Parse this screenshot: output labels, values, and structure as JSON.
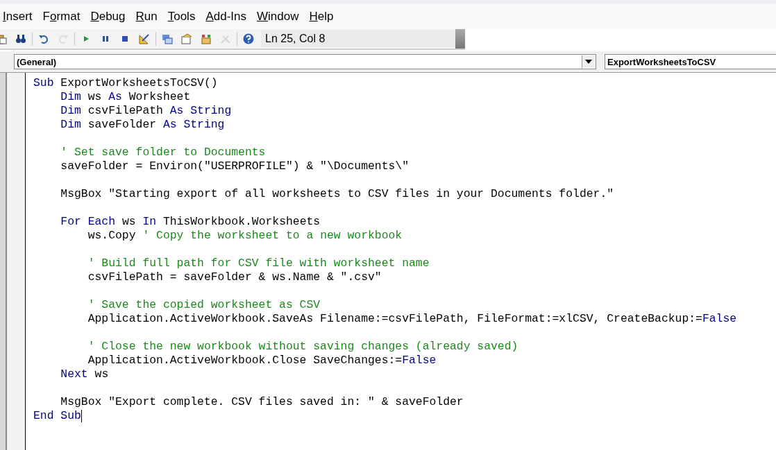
{
  "menu": [
    {
      "key": "I",
      "post": "nsert"
    },
    {
      "pre": "F",
      "key": "o",
      "post": "rmat"
    },
    {
      "key": "D",
      "post": "ebug"
    },
    {
      "key": "R",
      "post": "un"
    },
    {
      "key": "T",
      "post": "ools"
    },
    {
      "key": "A",
      "post": "dd-Ins"
    },
    {
      "key": "W",
      "post": "indow"
    },
    {
      "key": "H",
      "post": "elp"
    }
  ],
  "toolbar": [
    {
      "kind": "paste",
      "disabled": false
    },
    {
      "kind": "find",
      "disabled": false
    },
    {
      "kind": "sep"
    },
    {
      "kind": "undo",
      "disabled": false
    },
    {
      "kind": "redo",
      "disabled": true
    },
    {
      "kind": "sep"
    },
    {
      "kind": "run",
      "disabled": false
    },
    {
      "kind": "pause",
      "disabled": false
    },
    {
      "kind": "stop",
      "disabled": false
    },
    {
      "kind": "design",
      "disabled": false
    },
    {
      "kind": "sep"
    },
    {
      "kind": "explorer",
      "disabled": false
    },
    {
      "kind": "properties",
      "disabled": false
    },
    {
      "kind": "browser",
      "disabled": false
    },
    {
      "kind": "toolbox",
      "disabled": true
    },
    {
      "kind": "sep"
    },
    {
      "kind": "help",
      "disabled": false
    }
  ],
  "status": "Ln 25, Col 8",
  "object_dropdown": {
    "value": "(General)"
  },
  "procedure_dropdown": {
    "value": "ExportWorksheetsToCSV"
  },
  "code_lines": [
    [
      {
        "kind": "kw",
        "text": "Sub"
      },
      {
        "kind": "plain",
        "text": " ExportWorksheetsToCSV()"
      }
    ],
    [
      {
        "kind": "indent"
      },
      {
        "kind": "kw",
        "text": "Dim"
      },
      {
        "kind": "plain",
        "text": " ws "
      },
      {
        "kind": "kw",
        "text": "As"
      },
      {
        "kind": "plain",
        "text": " Worksheet"
      }
    ],
    [
      {
        "kind": "indent"
      },
      {
        "kind": "kw",
        "text": "Dim"
      },
      {
        "kind": "plain",
        "text": " csvFilePath "
      },
      {
        "kind": "kw",
        "text": "As String"
      }
    ],
    [
      {
        "kind": "indent"
      },
      {
        "kind": "kw",
        "text": "Dim"
      },
      {
        "kind": "plain",
        "text": " saveFolder "
      },
      {
        "kind": "kw",
        "text": "As String"
      }
    ],
    [
      {
        "kind": "blank"
      }
    ],
    [
      {
        "kind": "indent"
      },
      {
        "kind": "comment",
        "text": "' Set save folder to Documents"
      }
    ],
    [
      {
        "kind": "indent"
      },
      {
        "kind": "plain",
        "text": "saveFolder = Environ(\"USERPROFILE\") & \"\\Documents\\\""
      }
    ],
    [
      {
        "kind": "blank"
      }
    ],
    [
      {
        "kind": "indent"
      },
      {
        "kind": "plain",
        "text": "MsgBox \"Starting export of all worksheets to CSV files in your Documents folder.\""
      }
    ],
    [
      {
        "kind": "blank"
      }
    ],
    [
      {
        "kind": "indent"
      },
      {
        "kind": "kw",
        "text": "For Each"
      },
      {
        "kind": "plain",
        "text": " ws "
      },
      {
        "kind": "kw",
        "text": "In"
      },
      {
        "kind": "plain",
        "text": " ThisWorkbook.Worksheets"
      }
    ],
    [
      {
        "kind": "indent"
      },
      {
        "kind": "indent"
      },
      {
        "kind": "plain",
        "text": "ws.Copy "
      },
      {
        "kind": "comment",
        "text": "' Copy the worksheet to a new workbook"
      }
    ],
    [
      {
        "kind": "blank"
      }
    ],
    [
      {
        "kind": "indent"
      },
      {
        "kind": "indent"
      },
      {
        "kind": "comment",
        "text": "' Build full path for CSV file with worksheet name"
      }
    ],
    [
      {
        "kind": "indent"
      },
      {
        "kind": "indent"
      },
      {
        "kind": "plain",
        "text": "csvFilePath = saveFolder & ws.Name & \".csv\""
      }
    ],
    [
      {
        "kind": "blank"
      }
    ],
    [
      {
        "kind": "indent"
      },
      {
        "kind": "indent"
      },
      {
        "kind": "comment",
        "text": "' Save the copied worksheet as CSV"
      }
    ],
    [
      {
        "kind": "indent"
      },
      {
        "kind": "indent"
      },
      {
        "kind": "plain",
        "text": "Application.ActiveWorkbook.SaveAs Filename:=csvFilePath, FileFormat:=xlCSV, CreateBackup:="
      },
      {
        "kind": "kw",
        "text": "False"
      }
    ],
    [
      {
        "kind": "blank"
      }
    ],
    [
      {
        "kind": "indent"
      },
      {
        "kind": "indent"
      },
      {
        "kind": "comment",
        "text": "' Close the new workbook without saving changes (already saved)"
      }
    ],
    [
      {
        "kind": "indent"
      },
      {
        "kind": "indent"
      },
      {
        "kind": "plain",
        "text": "Application.ActiveWorkbook.Close SaveChanges:="
      },
      {
        "kind": "kw",
        "text": "False"
      }
    ],
    [
      {
        "kind": "indent"
      },
      {
        "kind": "kw",
        "text": "Next"
      },
      {
        "kind": "plain",
        "text": " ws"
      }
    ],
    [
      {
        "kind": "blank"
      }
    ],
    [
      {
        "kind": "indent"
      },
      {
        "kind": "plain",
        "text": "MsgBox \"Export complete. CSV files saved in: \" & saveFolder"
      }
    ],
    [
      {
        "kind": "kw",
        "text": "End Sub"
      },
      {
        "kind": "caret"
      }
    ]
  ]
}
